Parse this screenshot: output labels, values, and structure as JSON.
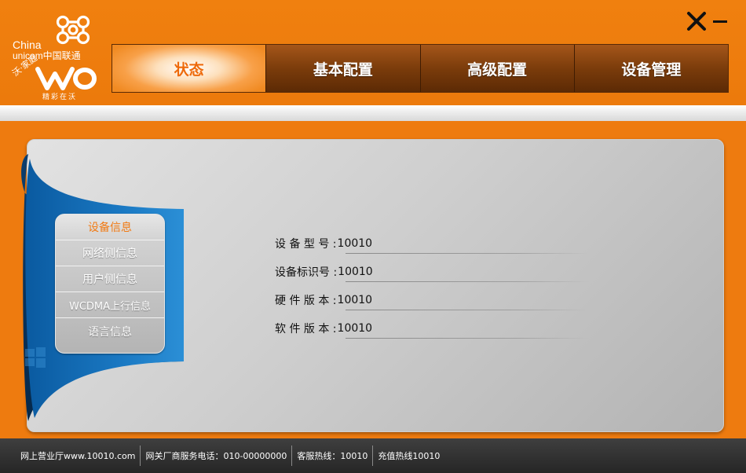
{
  "brand": {
    "line1": "China",
    "line2": "unicom中国联通",
    "product": "沃·家庭",
    "slogan": "精彩在沃",
    "accent_color": "#ee7b0f",
    "dark_color": "#6a3308"
  },
  "window_controls": {
    "close_icon": "close-icon",
    "minimize_icon": "minimize-icon"
  },
  "nav": {
    "tabs": [
      {
        "label": "状态",
        "active": true
      },
      {
        "label": "基本配置",
        "active": false
      },
      {
        "label": "高级配置",
        "active": false
      },
      {
        "label": "设备管理",
        "active": false
      }
    ]
  },
  "sidebar": {
    "items": [
      {
        "label": "设备信息",
        "active": true
      },
      {
        "label": "网络侧信息",
        "active": false
      },
      {
        "label": "用户侧信息",
        "active": false
      },
      {
        "label": "WCDMA上行信息",
        "active": false
      },
      {
        "label": "语言信息",
        "active": false
      }
    ]
  },
  "device_info": {
    "rows": [
      {
        "label": "设 备 型 号 :",
        "value": "10010"
      },
      {
        "label": "设备标识号 :",
        "value": "10010"
      },
      {
        "label": "硬 件 版 本 :",
        "value": "10010"
      },
      {
        "label": "软 件 版 本 :",
        "value": "10010"
      }
    ]
  },
  "footer": {
    "items": [
      "网上营业厅www.10010.com",
      "网关厂商服务电话：010-00000000",
      "客服热线：10010",
      "充值热线10010"
    ]
  }
}
